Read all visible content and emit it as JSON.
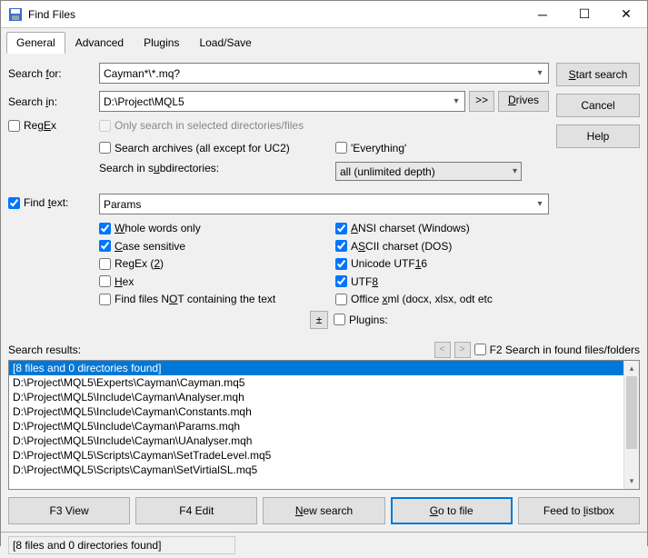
{
  "window": {
    "title": "Find Files"
  },
  "tabs": {
    "general": "General",
    "advanced": "Advanced",
    "plugins": "Plugins",
    "loadsave": "Load/Save"
  },
  "labels": {
    "search_for": "Search for:",
    "search_in": "Search in:",
    "regex": "RegEx",
    "only_selected": "Only search in selected directories/files",
    "search_archives": "Search archives (all except for UC2)",
    "everything": "'Everything'",
    "subdirs": "Search in subdirectories:",
    "find_text": "Find text:",
    "whole_words": "Whole words only",
    "case_sensitive": "Case sensitive",
    "regex2": "RegEx (2)",
    "hex": "Hex",
    "not_containing": "Find files NOT containing the text",
    "ansi": "ANSI charset (Windows)",
    "ascii": "ASCII charset (DOS)",
    "utf16": "Unicode UTF16",
    "utf8": "UTF8",
    "office": "Office xml (docx, xlsx, odt etc.)",
    "plugins": "Plugins:",
    "results": "Search results:",
    "f2": "F2 Search in found files/folders"
  },
  "buttons": {
    "start": "Start search",
    "cancel": "Cancel",
    "help": "Help",
    "more": ">>",
    "drives": "Drives",
    "plus": "±",
    "f3": "F3 View",
    "f4": "F4 Edit",
    "new_search": "New search",
    "goto": "Go to file",
    "feed": "Feed to listbox"
  },
  "values": {
    "search_for": "Cayman*\\*.mq?",
    "search_in": "D:\\Project\\MQL5",
    "depth": "all (unlimited depth)",
    "find_text": "Params"
  },
  "checks": {
    "regex": false,
    "only_selected": false,
    "search_archives": false,
    "everything": false,
    "find_text": true,
    "whole_words": true,
    "case_sensitive": true,
    "regex2": false,
    "hex": false,
    "not_containing": false,
    "ansi": true,
    "ascii": true,
    "utf16": true,
    "utf8": true,
    "office": false,
    "plugins": false,
    "f2": false
  },
  "results": {
    "header": "[8 files and 0 directories found]",
    "items": [
      "D:\\Project\\MQL5\\Experts\\Cayman\\Cayman.mq5",
      "D:\\Project\\MQL5\\Include\\Cayman\\Analyser.mqh",
      "D:\\Project\\MQL5\\Include\\Cayman\\Constants.mqh",
      "D:\\Project\\MQL5\\Include\\Cayman\\Params.mqh",
      "D:\\Project\\MQL5\\Include\\Cayman\\UAnalyser.mqh",
      "D:\\Project\\MQL5\\Scripts\\Cayman\\SetTradeLevel.mq5",
      "D:\\Project\\MQL5\\Scripts\\Cayman\\SetVirtialSL.mq5"
    ]
  },
  "status": "[8 files and 0 directories found]"
}
